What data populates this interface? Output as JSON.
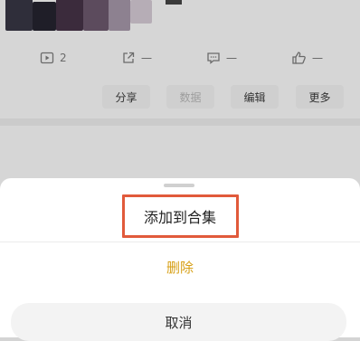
{
  "background": {
    "stats": {
      "plays_count": "2",
      "shares_count": "一",
      "comments_count": "一",
      "likes_count": "一"
    },
    "actions": {
      "share": "分享",
      "data": "数据",
      "edit": "编辑",
      "more": "更多"
    }
  },
  "sheet": {
    "add_to_collection": "添加到合集",
    "delete": "删除",
    "cancel": "取消"
  },
  "colors": {
    "delete_text": "#d7a017",
    "highlight_border": "#e15a3b"
  }
}
